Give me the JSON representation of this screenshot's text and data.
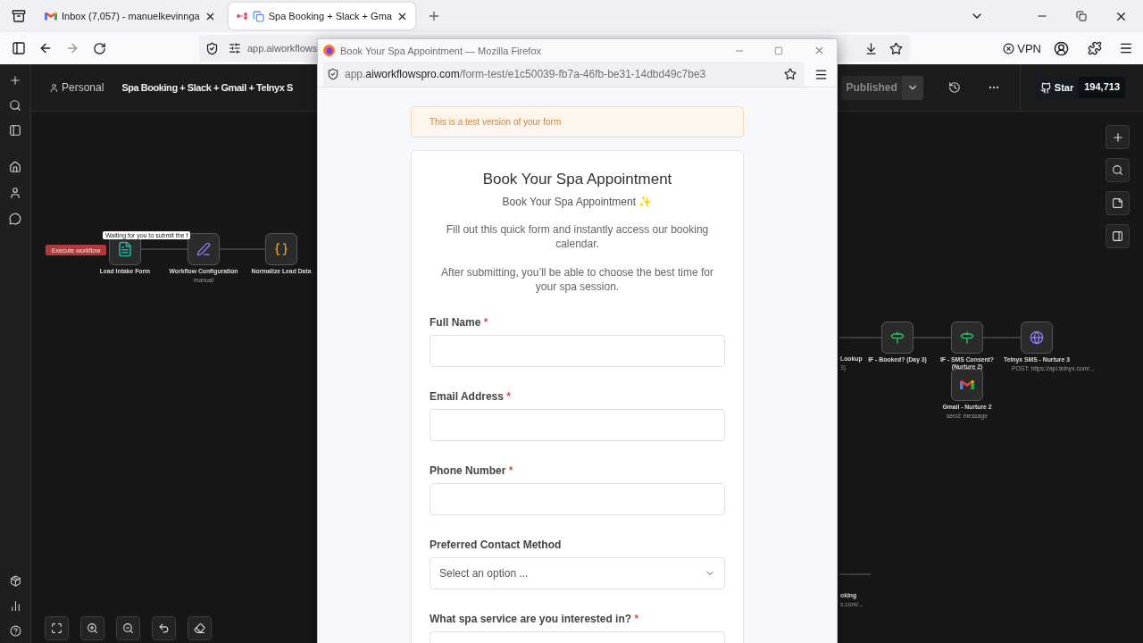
{
  "browser": {
    "tabs": [
      {
        "label": "Inbox (7,057) - manuelkevinnga",
        "selected": false,
        "kind": "mail"
      },
      {
        "label": "Spa Booking + Slack + Gma",
        "selected": true,
        "kind": "workflow"
      }
    ],
    "url": "app.aiworkflows",
    "vpn": "VPN"
  },
  "app": {
    "project": "Personal",
    "title": "Spa Booking + Slack + Gmail + Telnyx S",
    "publish_button": "Published",
    "github": {
      "label": "Star",
      "count": "194,713"
    }
  },
  "canvas": {
    "execute_button": "Execute workflow",
    "tooltip": "Waiting for you to submit the f",
    "nodes": [
      {
        "label": "Lead Intake Form",
        "kind": "form"
      },
      {
        "label": "Workflow Configuration",
        "sublabel": "manual",
        "kind": "pen"
      },
      {
        "label": "Normalize Lead Data",
        "kind": "code"
      },
      {
        "label": "Lookup",
        "sublabel": "3)",
        "kind": "hidden"
      },
      {
        "label": "IF - Booked? (Day 3)",
        "kind": "if"
      },
      {
        "label": "IF - SMS Consent? (Nurture 2)",
        "kind": "if"
      },
      {
        "label": "Telnyx SMS - Nurture 3",
        "sublabel": "POST: https://api.telnyx.com/...",
        "kind": "http"
      },
      {
        "label": "Gmail - Nurture 2",
        "sublabel": "send: message",
        "kind": "gmail"
      },
      {
        "label": "oking",
        "sublabel": "s.com/...",
        "kind": "hidden"
      }
    ]
  },
  "popup": {
    "title": "Book Your Spa Appointment — Mozilla Firefox",
    "url": {
      "prefix": "app.",
      "host": "aiworkflowspro.com",
      "path": "/form-test/e1c50039-fb7a-46fb-be31-14dbd49c7be3"
    },
    "banner": "This is a test version of your form",
    "form": {
      "title": "Book Your Spa Appointment",
      "subtitle": "Book Your Spa Appointment ✨",
      "paragraphs": [
        "Fill out this quick form and instantly access our booking calendar.",
        "After submitting, you’ll be able to choose the best time for your spa session."
      ],
      "fields": [
        {
          "label": "Full Name",
          "required_mark": "*",
          "kind": "text"
        },
        {
          "label": "Email Address",
          "required_mark": "*",
          "kind": "text"
        },
        {
          "label": "Phone Number",
          "required_mark": "*",
          "kind": "text"
        },
        {
          "label": "Preferred Contact Method",
          "kind": "select",
          "placeholder": "Select an option ..."
        },
        {
          "label": "What spa service are you interested in?",
          "required_mark": "*",
          "kind": "select"
        }
      ]
    }
  }
}
